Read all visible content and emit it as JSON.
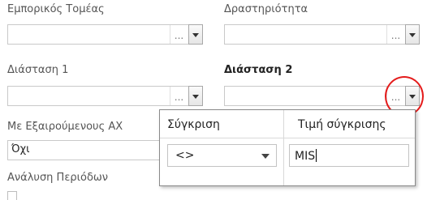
{
  "form": {
    "fields": [
      {
        "label": "Εμπορικός Τομέας",
        "value": "",
        "ellipsis": "..."
      },
      {
        "label": "Δραστηριότητα",
        "value": "",
        "ellipsis": "..."
      },
      {
        "label": "Διάσταση 1",
        "value": "",
        "ellipsis": "..."
      },
      {
        "label": "Διάσταση 2",
        "value": "",
        "ellipsis": "..."
      },
      {
        "label": "Με Εξαιρούμενους ΑΧ",
        "value": "Όχι"
      },
      {
        "label": "Ανάλυση Περιόδων"
      }
    ]
  },
  "popup": {
    "compare_header": "Σύγκριση",
    "value_header": "Τιμή σύγκρισης",
    "operator": "<>",
    "compare_value": "MIS"
  },
  "colors": {
    "highlight": "#e41c1c",
    "border": "#c9c9c9"
  }
}
